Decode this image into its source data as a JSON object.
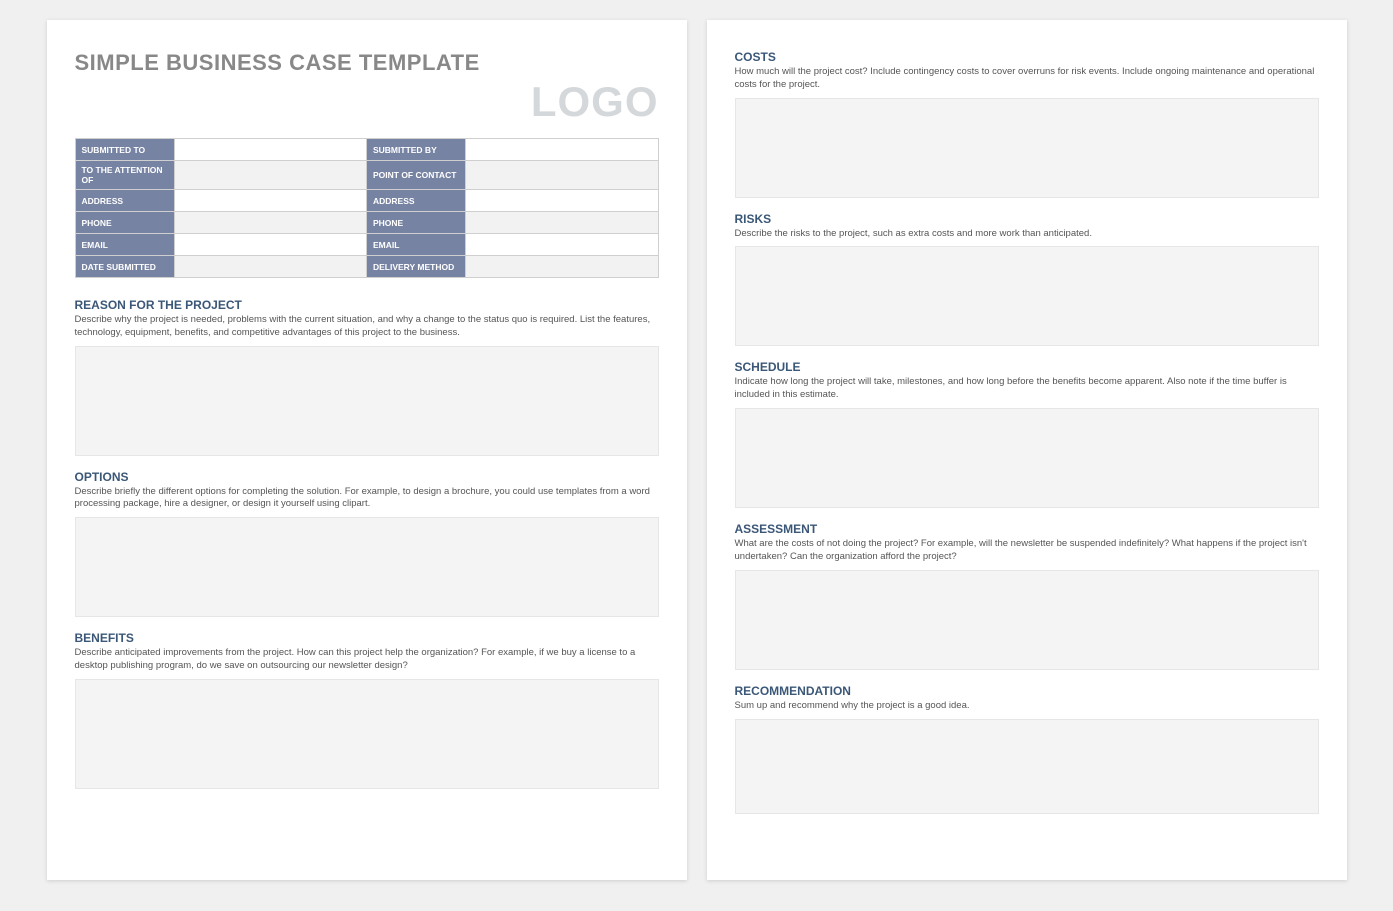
{
  "title": "SIMPLE BUSINESS CASE TEMPLATE",
  "logo": "LOGO",
  "info_rows": [
    {
      "l1": "SUBMITTED TO",
      "v1": "",
      "l2": "SUBMITTED BY",
      "v2": ""
    },
    {
      "l1": "TO THE ATTENTION OF",
      "v1": "",
      "l2": "POINT OF CONTACT",
      "v2": ""
    },
    {
      "l1": "ADDRESS",
      "v1": "",
      "l2": "ADDRESS",
      "v2": ""
    },
    {
      "l1": "PHONE",
      "v1": "",
      "l2": "PHONE",
      "v2": ""
    },
    {
      "l1": "EMAIL",
      "v1": "",
      "l2": "EMAIL",
      "v2": ""
    },
    {
      "l1": "DATE SUBMITTED",
      "v1": "",
      "l2": "DELIVERY METHOD",
      "v2": ""
    }
  ],
  "sections_p1": [
    {
      "title": "REASON FOR THE PROJECT",
      "desc": "Describe why the project is needed, problems with the current situation, and why a change to the status quo is required. List the features, technology, equipment, benefits, and competitive advantages of this project to the business.",
      "box": "box-lg"
    },
    {
      "title": "OPTIONS",
      "desc": "Describe briefly the different options for completing the solution. For example, to design a brochure, you could use templates from a word processing package, hire a designer, or design it yourself using clipart.",
      "box": "box-md"
    },
    {
      "title": "BENEFITS",
      "desc": "Describe anticipated improvements from the project. How can this project help the organization? For example, if we buy a license to a desktop publishing program, do we save on outsourcing our newsletter design?",
      "box": "box-lg"
    }
  ],
  "sections_p2": [
    {
      "title": "COSTS",
      "desc": "How much will the project cost? Include contingency costs to cover overruns for risk events. Include ongoing maintenance and operational costs for the project.",
      "box": "box-md"
    },
    {
      "title": "RISKS",
      "desc": "Describe the risks to the project, such as extra costs and more work than anticipated.",
      "box": "box-md"
    },
    {
      "title": "SCHEDULE",
      "desc": "Indicate how long the project will take, milestones, and how long before the benefits become apparent. Also note if the time buffer is included in this estimate.",
      "box": "box-md"
    },
    {
      "title": "ASSESSMENT",
      "desc": "What are the costs of not doing the project? For example, will the newsletter be suspended indefinitely? What happens if the project isn't undertaken? Can the organization afford the project?",
      "box": "box-md"
    },
    {
      "title": "RECOMMENDATION",
      "desc": "Sum up and recommend why the project is a good idea.",
      "box": "box-sm"
    }
  ]
}
